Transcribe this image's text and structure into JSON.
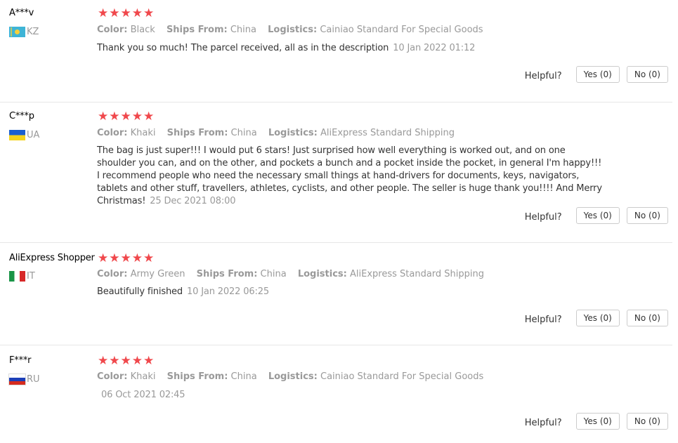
{
  "helpful_label": "Helpful?",
  "labels": {
    "color": "Color:",
    "ships_from": "Ships From:",
    "logistics": "Logistics:"
  },
  "star_color": "#f0484c",
  "reviews": [
    {
      "user": "A***v",
      "country": "KZ",
      "flag": "kazakhstan-flag-icon",
      "rating": 5,
      "stars": "★★★★★",
      "color": "Black",
      "ships_from": "China",
      "logistics": "Cainiao Standard For Special Goods",
      "text": "Thank you so much! The parcel received, all as in the description",
      "date": "10 Jan 2022 01:12",
      "yes": "Yes (0)",
      "no": "No (0)"
    },
    {
      "user": "C***p",
      "country": "UA",
      "flag": "ukraine-flag-icon",
      "rating": 5,
      "stars": "★★★★★",
      "color": "Khaki",
      "ships_from": "China",
      "logistics": "AliExpress Standard Shipping",
      "text": "The bag is just super!!! I would put 6 stars! Just surprised how well everything is worked out, and on one shoulder you can, and on the other, and pockets a bunch and a pocket inside the pocket, in general I'm happy!!! I recommend people who need the necessary small things at hand-drivers for documents, keys, navigators, tablets and other stuff, travellers, athletes, cyclists, and other people. The seller is huge thank you!!!! And Merry Christmas!",
      "date": "25 Dec 2021 08:00",
      "yes": "Yes (0)",
      "no": "No (0)"
    },
    {
      "user": "AliExpress Shopper",
      "country": "IT",
      "flag": "italy-flag-icon",
      "rating": 5,
      "stars": "★★★★★",
      "color": "Army Green",
      "ships_from": "China",
      "logistics": "AliExpress Standard Shipping",
      "text": "Beautifully finished",
      "date": "10 Jan 2022 06:25",
      "yes": "Yes (0)",
      "no": "No (0)"
    },
    {
      "user": "F***r",
      "country": "RU",
      "flag": "russia-flag-icon",
      "rating": 5,
      "stars": "★★★★★",
      "color": "Khaki",
      "ships_from": "China",
      "logistics": "Cainiao Standard For Special Goods",
      "text": "",
      "date": "06 Oct 2021 02:45",
      "yes": "Yes (0)",
      "no": "No (0)"
    }
  ]
}
